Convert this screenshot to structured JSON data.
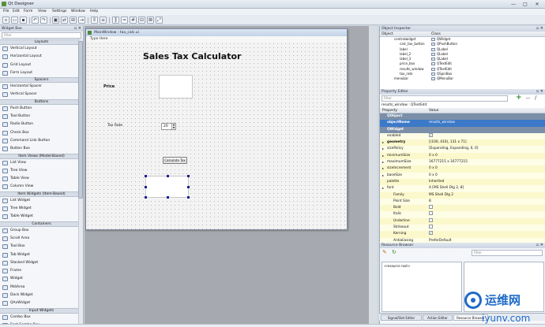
{
  "window": {
    "title": "Qt Designer",
    "min": "—",
    "max": "□",
    "close": "✕"
  },
  "menu": [
    "File",
    "Edit",
    "Form",
    "View",
    "Settings",
    "Window",
    "Help"
  ],
  "widget_box": {
    "title": "Widget Box",
    "filter_placeholder": "Filter",
    "items": [
      {
        "type": "cat",
        "label": "Layouts"
      },
      {
        "type": "item",
        "label": "Vertical Layout"
      },
      {
        "type": "item",
        "label": "Horizontal Layout"
      },
      {
        "type": "item",
        "label": "Grid Layout"
      },
      {
        "type": "item",
        "label": "Form Layout"
      },
      {
        "type": "cat",
        "label": "Spacers"
      },
      {
        "type": "item",
        "label": "Horizontal Spacer"
      },
      {
        "type": "item",
        "label": "Vertical Spacer"
      },
      {
        "type": "cat",
        "label": "Buttons"
      },
      {
        "type": "item",
        "label": "Push Button"
      },
      {
        "type": "item",
        "label": "Tool Button"
      },
      {
        "type": "item",
        "label": "Radio Button"
      },
      {
        "type": "item",
        "label": "Check Box"
      },
      {
        "type": "item",
        "label": "Command Link Button"
      },
      {
        "type": "item",
        "label": "Button Box"
      },
      {
        "type": "cat",
        "label": "Item Views (Model-Based)"
      },
      {
        "type": "item",
        "label": "List View"
      },
      {
        "type": "item",
        "label": "Tree View"
      },
      {
        "type": "item",
        "label": "Table View"
      },
      {
        "type": "item",
        "label": "Column View"
      },
      {
        "type": "cat",
        "label": "Item Widgets (Item-Based)"
      },
      {
        "type": "item",
        "label": "List Widget"
      },
      {
        "type": "item",
        "label": "Tree Widget"
      },
      {
        "type": "item",
        "label": "Table Widget"
      },
      {
        "type": "cat",
        "label": "Containers"
      },
      {
        "type": "item",
        "label": "Group Box"
      },
      {
        "type": "item",
        "label": "Scroll Area"
      },
      {
        "type": "item",
        "label": "Tool Box"
      },
      {
        "type": "item",
        "label": "Tab Widget"
      },
      {
        "type": "item",
        "label": "Stacked Widget"
      },
      {
        "type": "item",
        "label": "Frame"
      },
      {
        "type": "item",
        "label": "Widget"
      },
      {
        "type": "item",
        "label": "MdiArea"
      },
      {
        "type": "item",
        "label": "Dock Widget"
      },
      {
        "type": "item",
        "label": "QAxWidget"
      },
      {
        "type": "cat",
        "label": "Input Widgets"
      },
      {
        "type": "item",
        "label": "Combo Box"
      },
      {
        "type": "item",
        "label": "Font Combo Box"
      }
    ]
  },
  "form": {
    "title": "MainWindow - tax_calc.ui",
    "menu_placeholder": "Type Here",
    "heading": "Sales Tax Calculator",
    "price_label": "Price",
    "tax_label": "Tax Rate",
    "tax_value": "20",
    "calc_button": "Calculate Tax"
  },
  "object_inspector": {
    "title": "Object Inspector",
    "col_object": "Object",
    "col_class": "Class",
    "rows": [
      {
        "name": "centralwidget",
        "cls": "QWidget",
        "indent": 2
      },
      {
        "name": "calc_tax_button",
        "cls": "QPushButton",
        "indent": 3
      },
      {
        "name": "label",
        "cls": "QLabel",
        "indent": 3
      },
      {
        "name": "label_2",
        "cls": "QLabel",
        "indent": 3
      },
      {
        "name": "label_3",
        "cls": "QLabel",
        "indent": 3
      },
      {
        "name": "price_box",
        "cls": "QTextEdit",
        "indent": 3
      },
      {
        "name": "results_window",
        "cls": "QTextEdit",
        "indent": 3
      },
      {
        "name": "tax_rate",
        "cls": "QSpinBox",
        "indent": 3
      },
      {
        "name": "menubar",
        "cls": "QMenuBar",
        "indent": 2
      }
    ]
  },
  "property_editor": {
    "title": "Property Editor",
    "filter_placeholder": "Filter",
    "object_line": "results_window : QTextEdit",
    "col_property": "Property",
    "col_value": "Value",
    "rows": [
      {
        "kind": "cls",
        "name": "QObject",
        "value": ""
      },
      {
        "kind": "sel",
        "name": "objectName",
        "value": "results_window"
      },
      {
        "kind": "cls",
        "name": "QWidget",
        "value": ""
      },
      {
        "kind": "y",
        "name": "enabled",
        "value": "",
        "check": true
      },
      {
        "kind": "y2",
        "name": "geometry",
        "value": "[(100, 410), 131 x 71]",
        "expand": true
      },
      {
        "kind": "y",
        "name": "sizePolicy",
        "value": "[Expanding, Expanding, 0, 0]",
        "expand": true
      },
      {
        "kind": "y2",
        "name": "minimumSize",
        "value": "0 x 0",
        "expand": true
      },
      {
        "kind": "y",
        "name": "maximumSize",
        "value": "16777215 x 16777215",
        "expand": true
      },
      {
        "kind": "y2",
        "name": "sizeIncrement",
        "value": "0 x 0",
        "expand": true
      },
      {
        "kind": "y",
        "name": "baseSize",
        "value": "0 x 0",
        "expand": true
      },
      {
        "kind": "y2",
        "name": "palette",
        "value": "Inherited"
      },
      {
        "kind": "y",
        "name": "font",
        "value": "A  [MS Shell Dlg 2, 8]",
        "expand": true
      },
      {
        "kind": "y2",
        "name": "Family",
        "value": "MS Shell Dlg 2",
        "sub": true
      },
      {
        "kind": "y",
        "name": "Point Size",
        "value": "8",
        "sub": true
      },
      {
        "kind": "y2",
        "name": "Bold",
        "value": "",
        "check": false,
        "sub": true
      },
      {
        "kind": "y",
        "name": "Italic",
        "value": "",
        "check": false,
        "sub": true
      },
      {
        "kind": "y2",
        "name": "Underline",
        "value": "",
        "check": false,
        "sub": true
      },
      {
        "kind": "y",
        "name": "Strikeout",
        "value": "",
        "check": false,
        "sub": true
      },
      {
        "kind": "y2",
        "name": "Kerning",
        "value": "",
        "check": true,
        "sub": true
      },
      {
        "kind": "y",
        "name": "Antialiasing",
        "value": "PreferDefault",
        "sub": true
      }
    ]
  },
  "resource_browser": {
    "title": "Resource Browser",
    "filter_placeholder": "Filter",
    "root": "<resource root>"
  },
  "tabs": [
    "Signal/Slot Editor",
    "Action Editor",
    "Resource Browser"
  ],
  "watermark": {
    "cn": "运维网",
    "en": "iyunv.com"
  }
}
